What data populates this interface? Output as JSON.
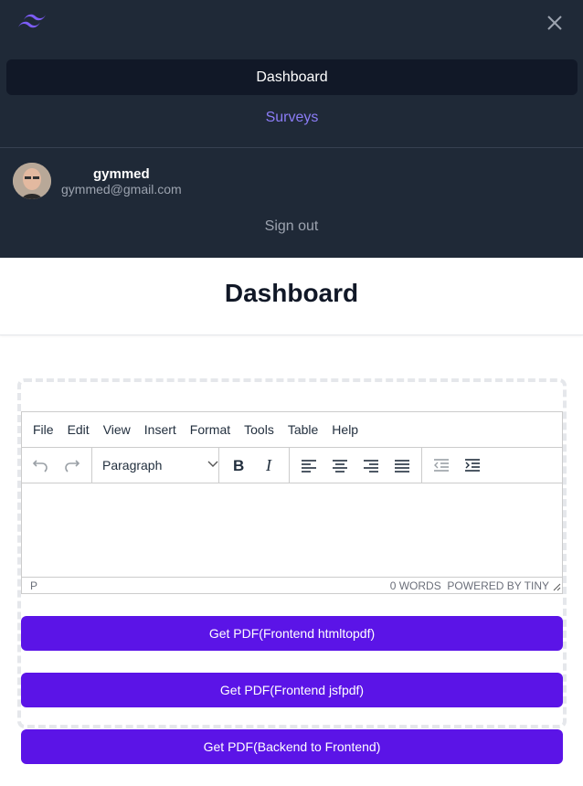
{
  "nav": {
    "logo_icon": "tailwind-logo-icon",
    "close_icon": "close-icon",
    "items": [
      {
        "label": "Dashboard",
        "active": true
      },
      {
        "label": "Surveys",
        "active": false
      }
    ],
    "accent_color": "#8b7cf6",
    "background_color": "#1f2937"
  },
  "user": {
    "name": "gymmed",
    "email": "gymmed@gmail.com",
    "sign_out_label": "Sign out"
  },
  "page": {
    "title": "Dashboard"
  },
  "editor": {
    "menu": [
      "File",
      "Edit",
      "View",
      "Insert",
      "Format",
      "Tools",
      "Table",
      "Help"
    ],
    "format_value": "Paragraph",
    "toolbar_icons": [
      "undo-icon",
      "redo-icon",
      "bold-icon",
      "italic-icon",
      "align-left-icon",
      "align-center-icon",
      "align-right-icon",
      "align-justify-icon",
      "outdent-icon",
      "indent-icon"
    ],
    "status_path": "P",
    "status_words": "0 WORDS",
    "status_powered": "POWERED BY TINY"
  },
  "buttons": {
    "pdf_html": "Get PDF(Frontend htmltopdf)",
    "pdf_js": "Get PDF(Frontend jsfpdf)",
    "pdf_backend": "Get PDF(Backend to Frontend)",
    "color": "#5b14e7"
  }
}
